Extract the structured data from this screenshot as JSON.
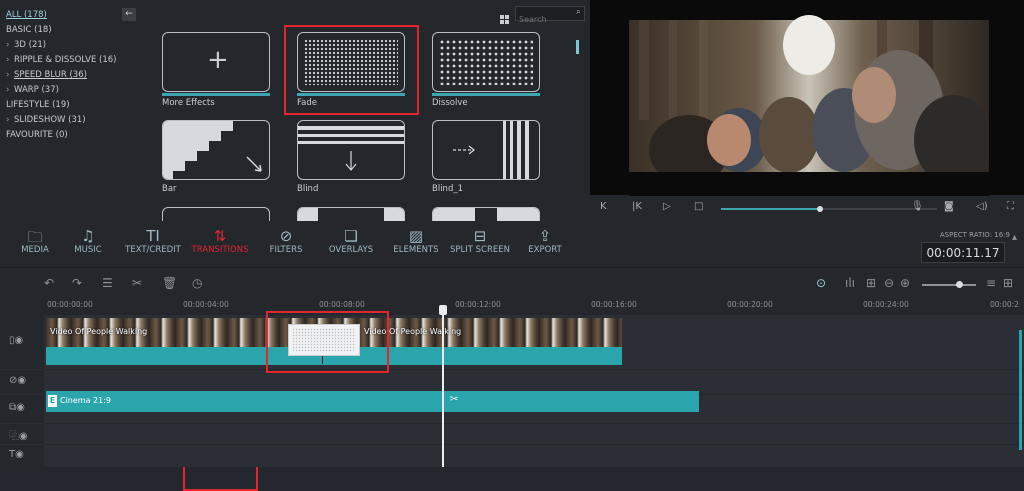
{
  "categories": [
    {
      "label": "ALL (178)",
      "arrow": false,
      "underline": true
    },
    {
      "label": "BASIC (18)",
      "arrow": false,
      "underline": false
    },
    {
      "label": "3D (21)",
      "arrow": true,
      "underline": false
    },
    {
      "label": "RIPPLE & DISSOLVE (16)",
      "arrow": true,
      "underline": false
    },
    {
      "label": "SPEED BLUR (36)",
      "arrow": true,
      "underline": true
    },
    {
      "label": "WARP (37)",
      "arrow": true,
      "underline": false
    },
    {
      "label": "LIFESTYLE (19)",
      "arrow": false,
      "underline": false
    },
    {
      "label": "SLIDESHOW (31)",
      "arrow": true,
      "underline": false
    },
    {
      "label": "FAVOURITE (0)",
      "arrow": false,
      "underline": false
    }
  ],
  "search": {
    "placeholder": "Search"
  },
  "transitions": [
    {
      "label": "More Effects"
    },
    {
      "label": "Fade"
    },
    {
      "label": "Dissolve"
    },
    {
      "label": "Bar"
    },
    {
      "label": "Blind"
    },
    {
      "label": "Blind_1"
    }
  ],
  "toolbar": {
    "media": "MEDIA",
    "music": "MUSIC",
    "text_credit": "TEXT/CREDIT",
    "transitions": "TRANSITIONS",
    "filters": "FILTERS",
    "overlays": "OVERLAYS",
    "elements": "ELEMENTS",
    "split_screen": "SPLIT SCREEN",
    "export": "EXPORT"
  },
  "aspect_ratio": "ASPECT RATIO: 16:9",
  "timecode": "00:00:11.17",
  "playback_progress_percent": 46,
  "ruler_ticks": [
    "00:00:00:00",
    "00:00:04:00",
    "00:00:08:00",
    "00:00:12:00",
    "00:00:16:00",
    "00:00:20:00",
    "00:00:24:00",
    "00:00:2"
  ],
  "clips": {
    "video_left": "Video Of People Walking",
    "video_right": "Video Of People Walking",
    "audio": "Cinema 21:9",
    "audio_badge": "E"
  },
  "colors": {
    "accent": "#2aa5ac",
    "highlight": "#e2262c"
  }
}
